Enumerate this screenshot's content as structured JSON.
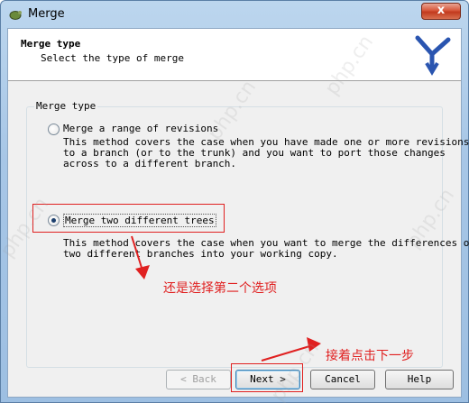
{
  "window": {
    "title": "Merge",
    "close_label": "x"
  },
  "header": {
    "title": "Merge type",
    "subtitle": "Select the type of merge"
  },
  "group": {
    "legend": "Merge type"
  },
  "options": [
    {
      "label": "Merge a range of revisions",
      "checked": false,
      "description": "This method covers the case when you have made one or more revisions\nto a branch (or to the trunk) and you want to port those changes\nacross to a different branch."
    },
    {
      "label": "Merge two different trees",
      "checked": true,
      "description": "This method covers the case when you want to merge the differences of\ntwo different branches into your working copy."
    }
  ],
  "annotations": {
    "select_second": "还是选择第二个选项",
    "click_next": "接着点击下一步"
  },
  "buttons": {
    "back": "< Back",
    "next": "Next >",
    "cancel": "Cancel",
    "help": "Help"
  },
  "watermark": "php.cn",
  "colors": {
    "annotation": "#e02020",
    "titlebar": "#a7c6e6",
    "close": "#c23a1e"
  }
}
